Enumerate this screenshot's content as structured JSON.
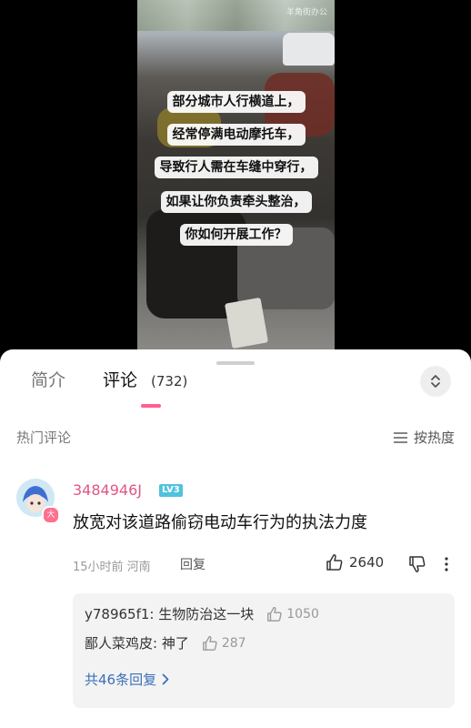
{
  "video": {
    "watermark": "羊角街办公",
    "captions": [
      "部分城市人行横道上，",
      "经常停满电动摩托车，",
      "导致行人需在车缝中穿行，",
      "如果让你负责牵头整治，",
      "你如何开展工作？"
    ]
  },
  "tabs": {
    "intro": "简介",
    "comments": "评论",
    "comments_count": "(732)"
  },
  "comments_header": {
    "hot_label": "热门评论",
    "sort_label": "按热度"
  },
  "comment": {
    "username": "3484946J",
    "level": "LV3",
    "avatar_badge": "大",
    "text": "放宽对该道路偷窃电动车行为的执法力度",
    "time_location": "15小时前 河南",
    "reply_label": "回复",
    "likes": "2640"
  },
  "replies": [
    {
      "author": "y78965f1",
      "text": "生物防治这一块",
      "likes": "1050"
    },
    {
      "author": "鄙人菜鸡皮",
      "text": "神了",
      "likes": "287"
    }
  ],
  "total_replies": "共46条回复",
  "colors": {
    "accent_pink": "#ff5e8f",
    "username_pink": "#e05585",
    "link_blue": "#3c6fb8",
    "level_badge": "#4fc3dd"
  }
}
